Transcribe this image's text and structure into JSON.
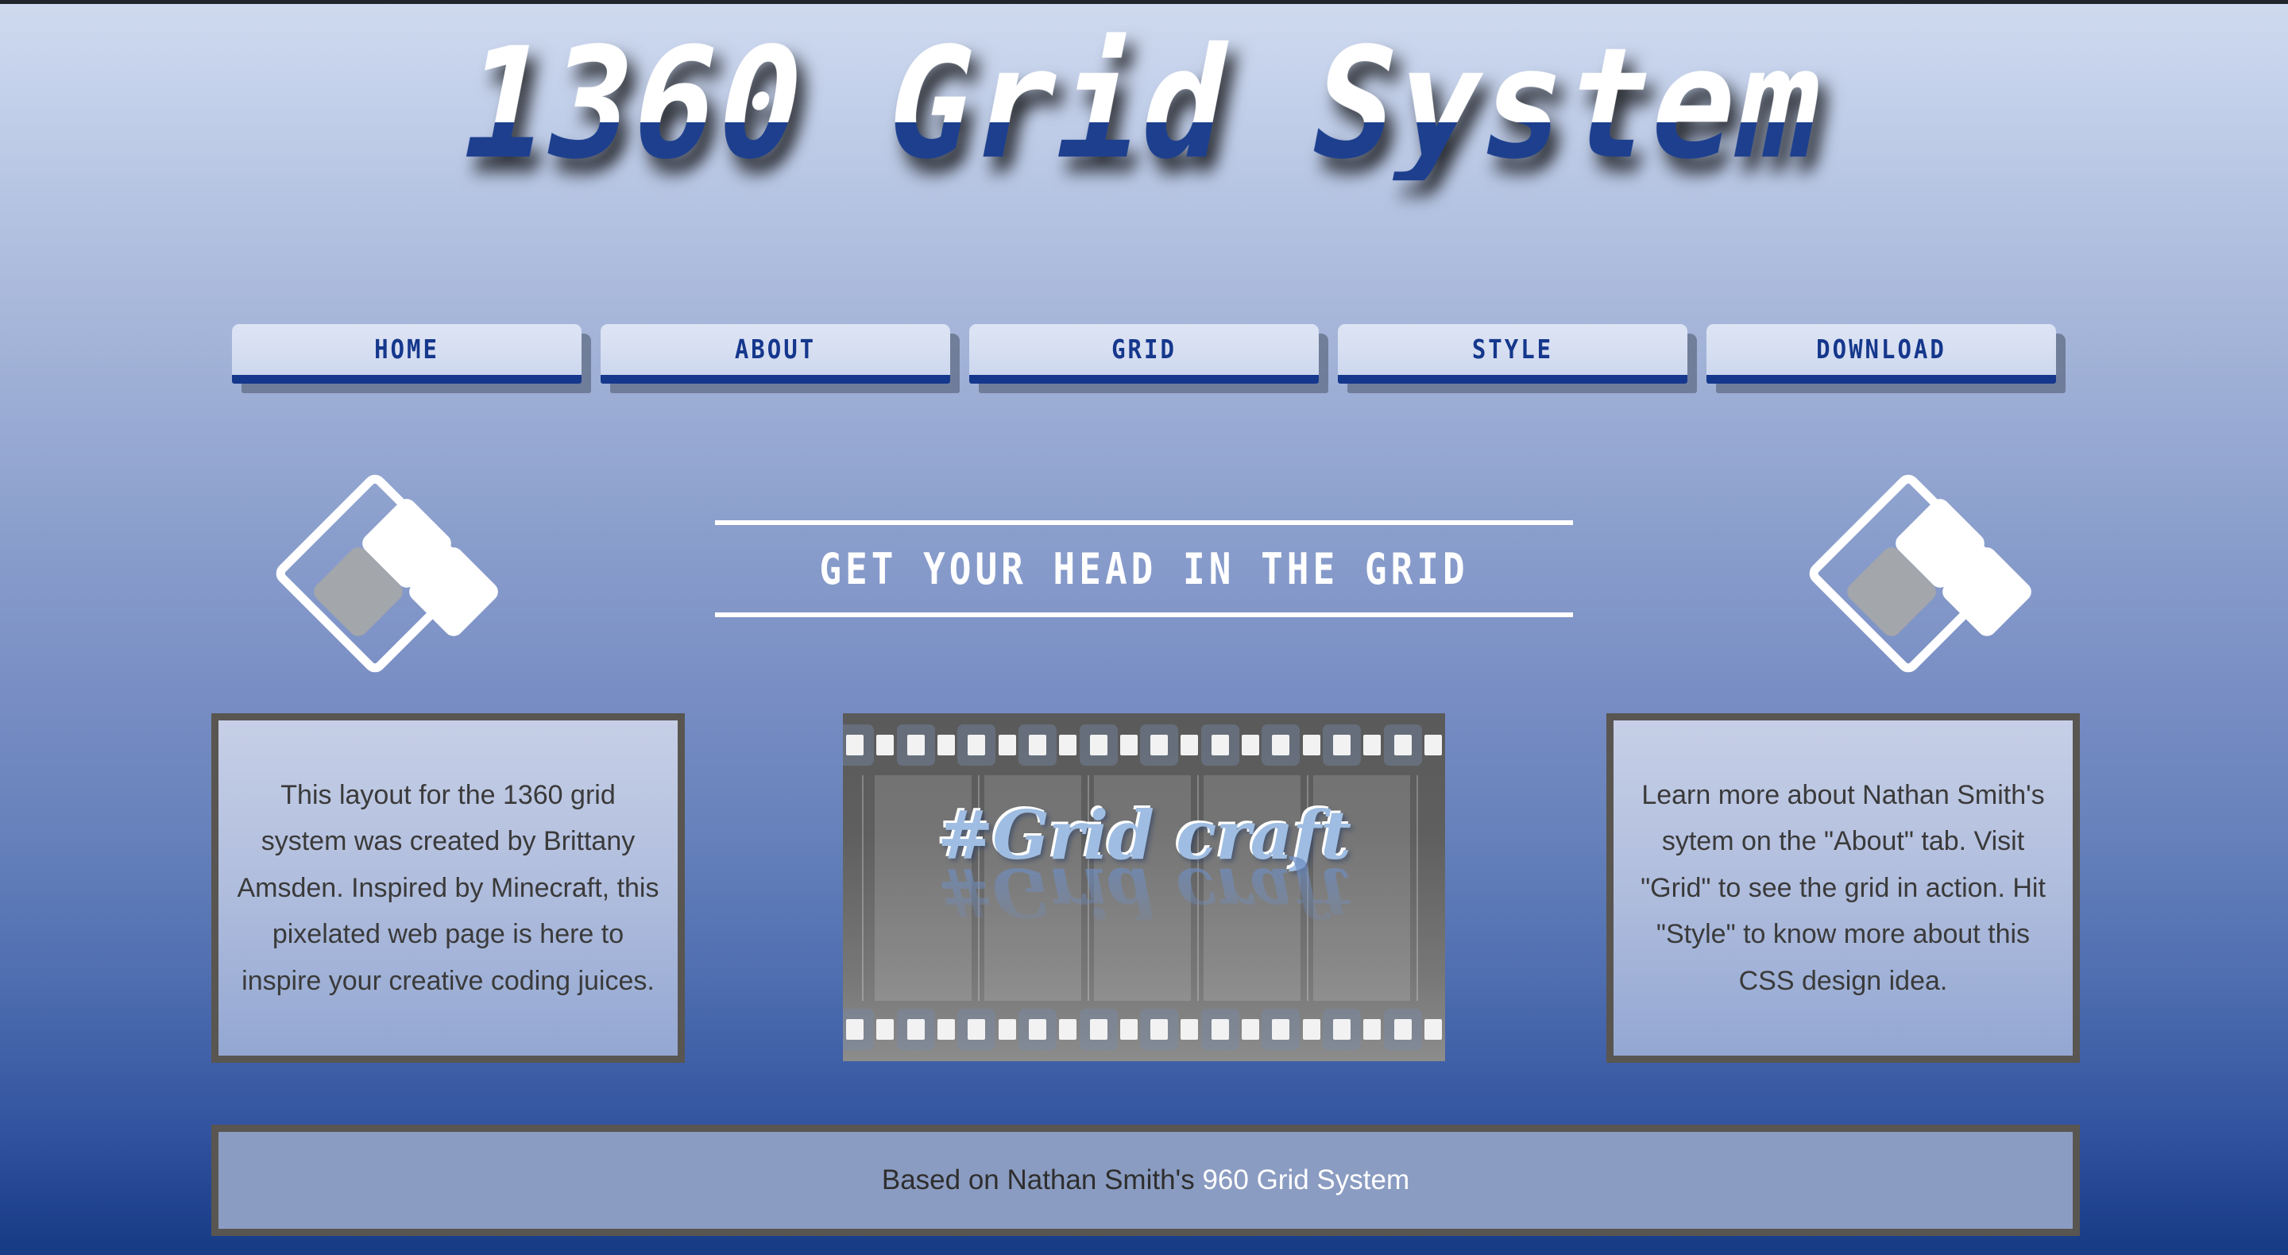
{
  "page": {
    "title": "1360 Grid System",
    "top_strip_color": "#22262c",
    "background_top_color": "#cfdaef",
    "background_bottom_color": "#173a85",
    "accent_blue": "#15378c",
    "border_gray": "#595551"
  },
  "nav": {
    "items": [
      {
        "label": "HOME"
      },
      {
        "label": "ABOUT"
      },
      {
        "label": "GRID"
      },
      {
        "label": "STYLE"
      },
      {
        "label": "DOWNLOAD"
      }
    ]
  },
  "main": {
    "headline": "GET YOUR HEAD IN THE GRID",
    "left_card": {
      "text": "This layout for the 1360 grid system was created by Brittany Amsden. Inspired by Minecraft, this pixelated web page is here to inspire your creative coding juices."
    },
    "right_card": {
      "text": "Learn more about Nathan Smith's sytem on the \"About\" tab. Visit \"Grid\" to see the grid in action. Hit \"Style\" to know more about this CSS design idea."
    },
    "film": {
      "caption": "#Grid craft",
      "caption_reflection": "#Grid craft",
      "caption_color": "#9fbde2"
    },
    "decoration": {
      "left_diamond_label": "pixel-diamond-logo",
      "right_diamond_label": "pixel-diamond-logo"
    }
  },
  "footer": {
    "prefix": "Based on Nathan Smith's ",
    "link_label": "960 Grid System"
  }
}
